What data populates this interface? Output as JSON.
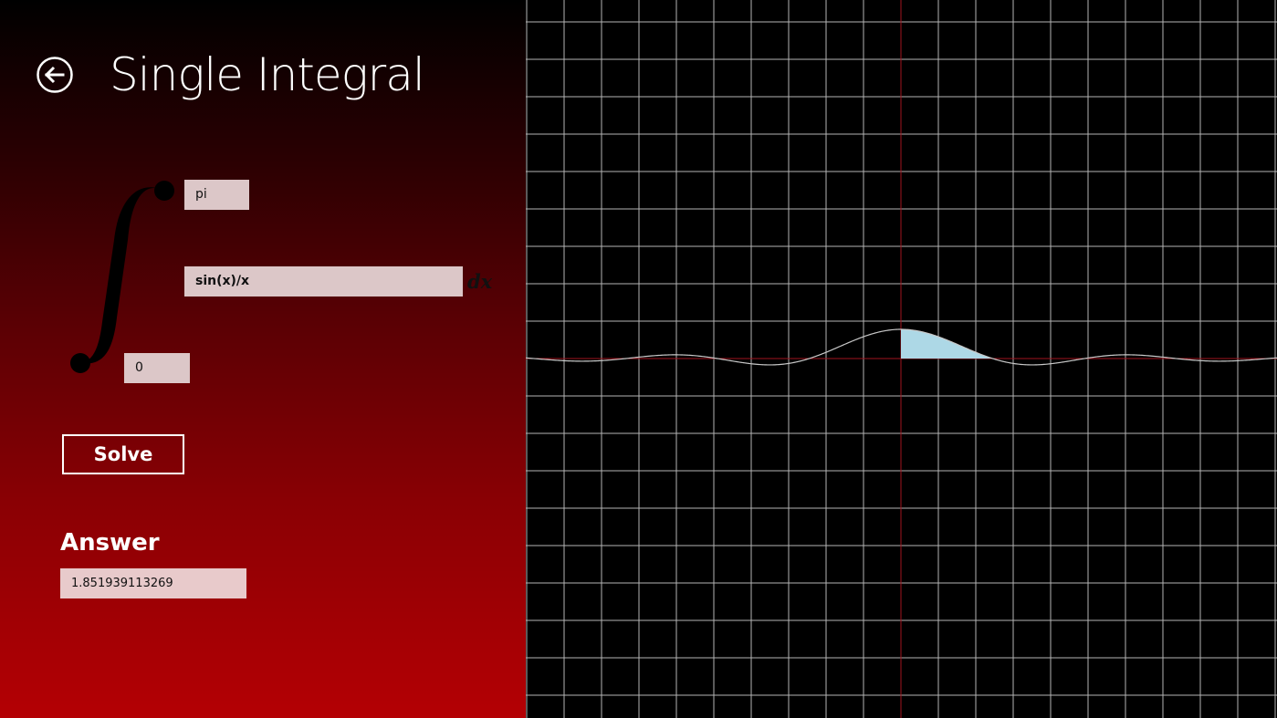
{
  "app": {
    "title": "Single Integral"
  },
  "inputs": {
    "upper_limit": "pi",
    "integrand": "sin(x)/x",
    "lower_limit": "0",
    "differential": "dx"
  },
  "solve": {
    "label": "Solve"
  },
  "answer": {
    "heading": "Answer",
    "value": "1.851939113269"
  },
  "icons": {
    "back": "back-arrow-icon",
    "integral": "integral-sign-icon"
  },
  "colors": {
    "gradient_top": "#000000",
    "gradient_bottom": "#b40004",
    "field_bg": "#dcc7c8",
    "grid_line": "#b4b4b4",
    "axis_line": "#a0141e",
    "curve": "#c8c8c8",
    "area_fill": "#add8e6"
  },
  "chart_data": {
    "type": "area",
    "function": "sin(x)/x",
    "shaded_interval": [
      0,
      3.14159
    ],
    "xlim": [
      -12.8,
      12.8
    ],
    "ylim": [
      -9.6,
      14.5
    ],
    "grid": true
  }
}
